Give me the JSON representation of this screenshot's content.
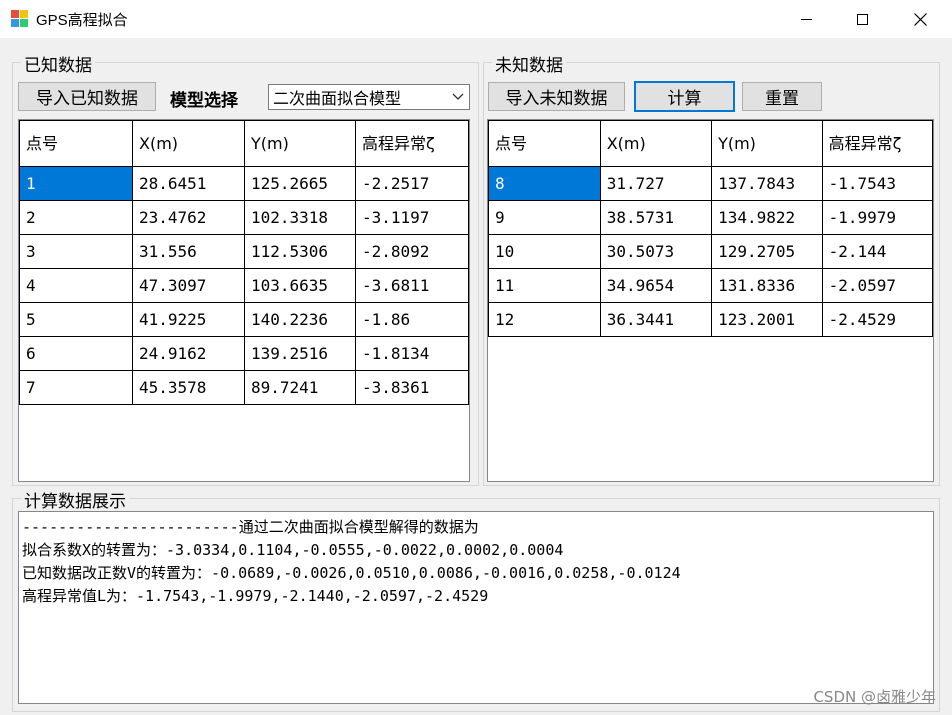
{
  "window": {
    "title": "GPS高程拟合",
    "icon_colors": [
      "#e74c3c",
      "#f1c40f",
      "#3498db",
      "#2ecc71"
    ]
  },
  "known": {
    "group_label": "已知数据",
    "import_button": "导入已知数据",
    "model_label": "模型选择",
    "model_selected": "二次曲面拟合模型",
    "columns": [
      "点号",
      "X(m)",
      "Y(m)",
      "高程异常ζ"
    ],
    "rows": [
      [
        "1",
        "28.6451",
        "125.2665",
        "-2.2517"
      ],
      [
        "2",
        "23.4762",
        "102.3318",
        "-3.1197"
      ],
      [
        "3",
        "31.556",
        "112.5306",
        "-2.8092"
      ],
      [
        "4",
        "47.3097",
        "103.6635",
        "-3.6811"
      ],
      [
        "5",
        "41.9225",
        "140.2236",
        "-1.86"
      ],
      [
        "6",
        "24.9162",
        "139.2516",
        "-1.8134"
      ],
      [
        "7",
        "45.3578",
        "89.7241",
        "-3.8361"
      ]
    ]
  },
  "unknown": {
    "group_label": "未知数据",
    "import_button": "导入未知数据",
    "calc_button": "计算",
    "reset_button": "重置",
    "columns": [
      "点号",
      "X(m)",
      "Y(m)",
      "高程异常ζ"
    ],
    "rows": [
      [
        "8",
        "31.727",
        "137.7843",
        "-1.7543"
      ],
      [
        "9",
        "38.5731",
        "134.9822",
        "-1.9979"
      ],
      [
        "10",
        "30.5073",
        "129.2705",
        "-2.144"
      ],
      [
        "11",
        "34.9654",
        "131.8336",
        "-2.0597"
      ],
      [
        "12",
        "36.3441",
        "123.2001",
        "-2.4529"
      ]
    ]
  },
  "output": {
    "group_label": "计算数据展示",
    "lines": [
      "------------------------通过二次曲面拟合模型解得的数据为",
      "拟合系数X的转置为：-3.0334,0.1104,-0.0555,-0.0022,0.0002,0.0004",
      "已知数据改正数V的转置为：-0.0689,-0.0026,0.0510,0.0086,-0.0016,0.0258,-0.0124",
      "高程异常值L为：-1.7543,-1.9979,-2.1440,-2.0597,-2.4529"
    ]
  },
  "watermark": "CSDN @卤雅少年"
}
